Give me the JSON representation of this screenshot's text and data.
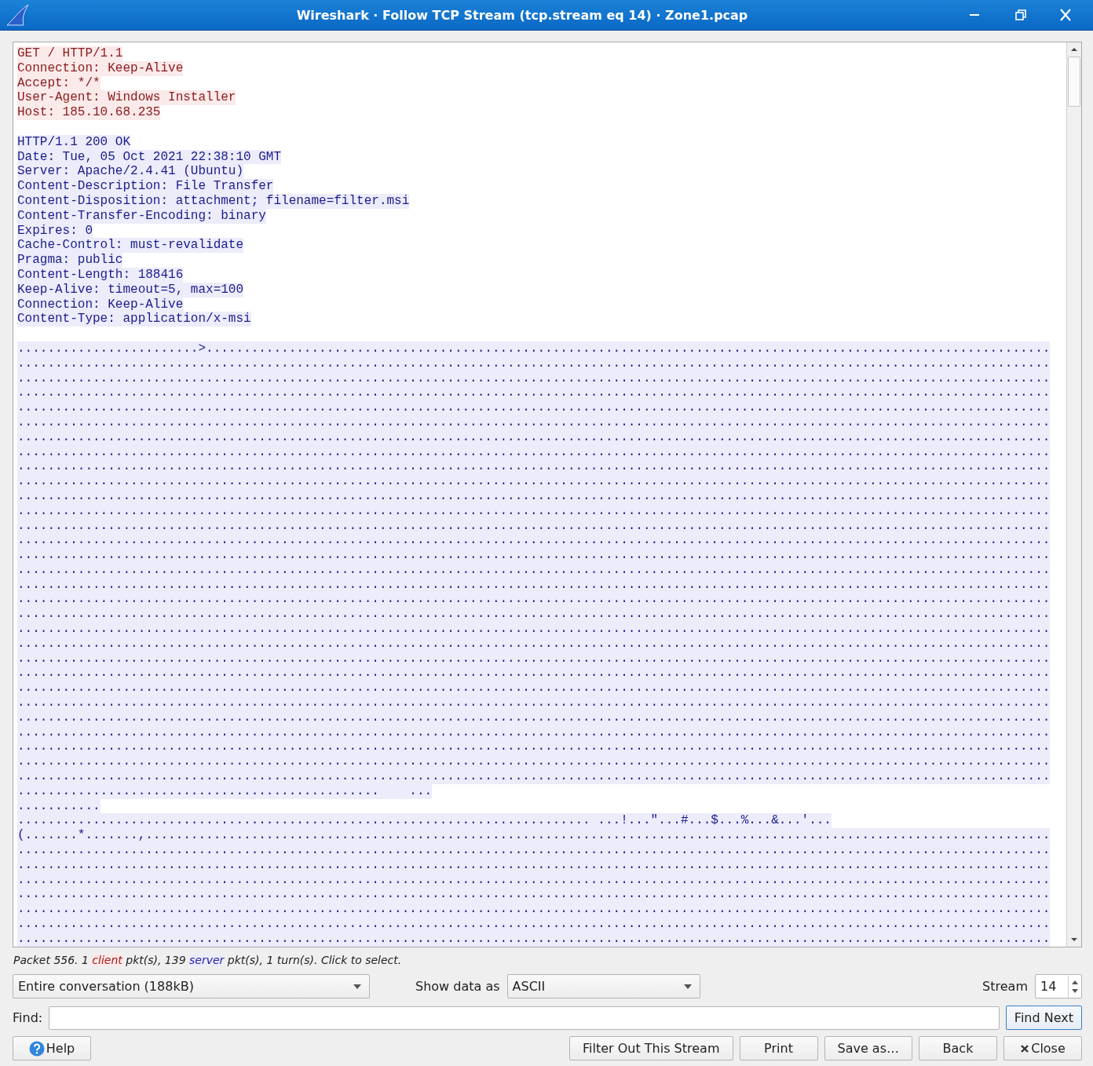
{
  "window": {
    "title": "Wireshark · Follow TCP Stream (tcp.stream eq 14) · Zone1.pcap"
  },
  "stream": [
    {
      "kind": "client",
      "lines": [
        "GET / HTTP/1.1",
        "Connection: Keep-Alive",
        "Accept: */*",
        "User-Agent: Windows Installer",
        "Host: 185.10.68.235"
      ]
    },
    {
      "kind": "server",
      "lines": [
        "HTTP/1.1 200 OK",
        "Date: Tue, 05 Oct 2021 22:38:10 GMT",
        "Server: Apache/2.4.41 (Ubuntu)",
        "Content-Description: File Transfer",
        "Content-Disposition: attachment; filename=filter.msi",
        "Content-Transfer-Encoding: binary",
        "Expires: 0",
        "Cache-Control: must-revalidate",
        "Pragma: public",
        "Content-Length: 188416",
        "Keep-Alive: timeout=5, max=100",
        "Connection: Keep-Alive",
        "Content-Type: application/x-msi"
      ]
    },
    {
      "kind": "server",
      "lines": [
        "........................>................................................................................................................",
        ".........................................................................................................................................",
        ".........................................................................................................................................",
        ".........................................................................................................................................",
        ".........................................................................................................................................",
        ".........................................................................................................................................",
        ".........................................................................................................................................",
        ".........................................................................................................................................",
        ".........................................................................................................................................",
        ".........................................................................................................................................",
        ".........................................................................................................................................",
        ".........................................................................................................................................",
        ".........................................................................................................................................",
        ".........................................................................................................................................",
        ".........................................................................................................................................",
        ".........................................................................................................................................",
        ".........................................................................................................................................",
        ".........................................................................................................................................",
        ".........................................................................................................................................",
        ".........................................................................................................................................",
        ".........................................................................................................................................",
        ".........................................................................................................................................",
        ".........................................................................................................................................",
        ".........................................................................................................................................",
        ".........................................................................................................................................",
        ".........................................................................................................................................",
        ".........................................................................................................................................",
        ".........................................................................................................................................",
        ".........................................................................................................................................",
        ".........................................................................................................................................",
        "................................................    ...",
        "...........",
        "............................................................................ ...!...\"...#...$...%...&...'...",
        "(.......*.......,........................................................................................................................",
        ".........................................................................................................................................",
        ".........................................................................................................................................",
        ".........................................................................................................................................",
        ".........................................................................................................................................",
        ".........................................................................................................................................",
        ".........................................................................................................................................",
        "........................................................................................................................................."
      ]
    }
  ],
  "status": [
    {
      "text": "Packet 556. 1 ",
      "kind": "plain"
    },
    {
      "text": "client",
      "kind": "client"
    },
    {
      "text": " pkt(s), 139 ",
      "kind": "plain"
    },
    {
      "text": "server",
      "kind": "server"
    },
    {
      "text": " pkt(s), 1 turn(s). Click to select.",
      "kind": "plain"
    }
  ],
  "conversation": {
    "value": "Entire conversation (188kB)"
  },
  "show_data": {
    "label": "Show data as",
    "value": "ASCII"
  },
  "stream_index": {
    "label": "Stream",
    "value": "14"
  },
  "find": {
    "label": "Find:",
    "button": "Find Next",
    "button_default": true
  },
  "buttons": [
    {
      "label": "Help",
      "kind": "help"
    },
    {
      "label": "Filter Out This Stream",
      "kind": "plain"
    },
    {
      "label": "Print",
      "kind": "plain"
    },
    {
      "label": "Save as…",
      "kind": "plain"
    },
    {
      "label": "Back",
      "kind": "plain"
    },
    {
      "label": "Close",
      "kind": "close"
    }
  ]
}
